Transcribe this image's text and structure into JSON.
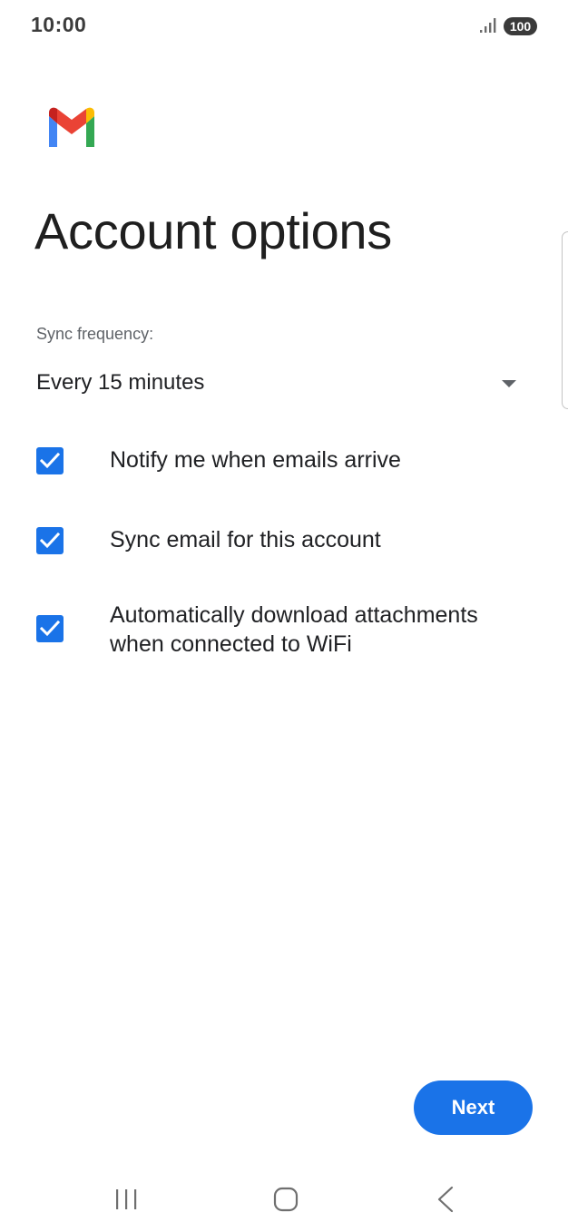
{
  "status_bar": {
    "time": "10:00",
    "battery_level": "100",
    "icons": [
      "signal-icon",
      "battery-icon"
    ]
  },
  "header": {
    "logo": "gmail-logo",
    "title": "Account options"
  },
  "sync": {
    "label": "Sync frequency:",
    "selected_value": "Every 15 minutes",
    "icon": "dropdown-arrow-icon"
  },
  "options": [
    {
      "label": "Notify me when emails arrive",
      "checked": true
    },
    {
      "label": "Sync email for this account",
      "checked": true
    },
    {
      "label": "Automatically download attachments when connected to WiFi",
      "checked": true
    }
  ],
  "footer": {
    "next_label": "Next"
  },
  "nav_bar": {
    "icons": [
      "recents-icon",
      "home-icon",
      "back-icon"
    ]
  },
  "colors": {
    "accent": "#1a73e8",
    "text_primary": "#202124",
    "text_secondary": "#5f6368",
    "background": "#ffffff"
  }
}
